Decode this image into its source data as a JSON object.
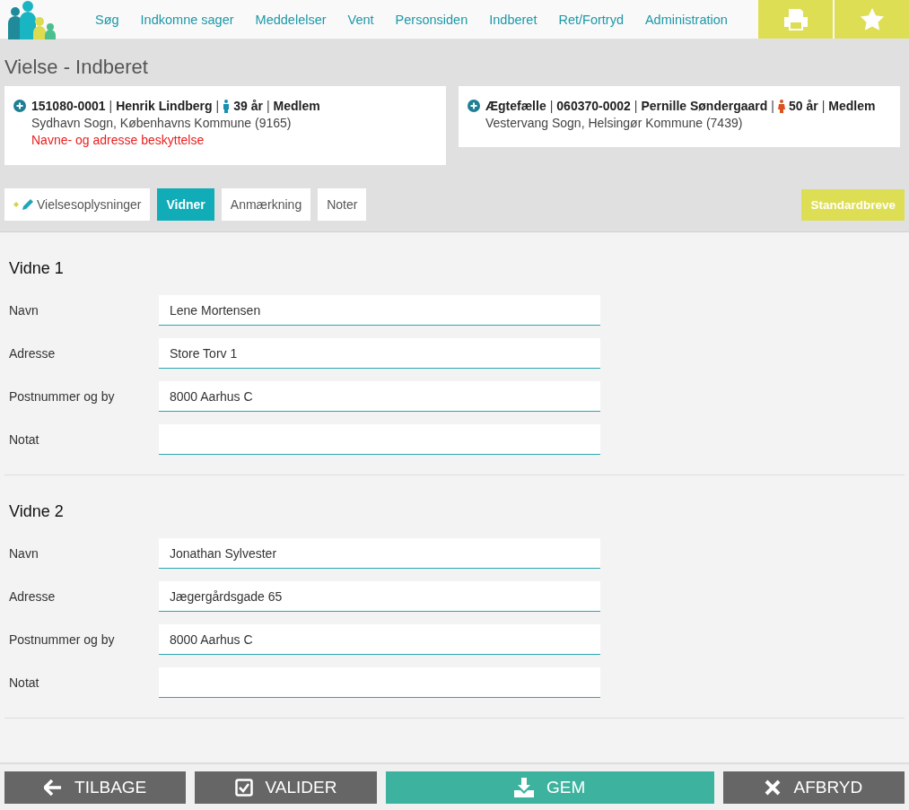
{
  "nav": {
    "items": [
      {
        "label": "Søg"
      },
      {
        "label": "Indkomne sager"
      },
      {
        "label": "Meddelelser"
      },
      {
        "label": "Vent"
      },
      {
        "label": "Personsiden"
      },
      {
        "label": "Indberet"
      },
      {
        "label": "Ret/Fortryd"
      },
      {
        "label": "Administration"
      }
    ],
    "actions": [
      {
        "kind": "print"
      },
      {
        "kind": "favorite"
      }
    ]
  },
  "page_title": "Vielse - Indberet",
  "persons": [
    {
      "separator": "|",
      "parts": [
        {
          "text": "151080-0001"
        },
        {
          "text": "Henrik Lindberg"
        },
        {
          "text": "39 år",
          "kind": "male"
        },
        {
          "text": "Medlem"
        }
      ],
      "address": "Sydhavn Sogn, Københavns Kommune (9165)",
      "warning": "Navne- og adresse beskyttelse"
    },
    {
      "separator": "|",
      "parts": [
        {
          "text": "Ægtefælle"
        },
        {
          "text": "060370-0002"
        },
        {
          "text": "Pernille Søndergaard"
        },
        {
          "text": "50 år",
          "kind": "female"
        },
        {
          "text": "Medlem"
        }
      ],
      "address": "Vestervang Sogn, Helsingør Kommune (7439)"
    }
  ],
  "tabs": [
    {
      "label": "Vielsesoplysninger",
      "selected": false,
      "edited": true
    },
    {
      "label": "Vidner",
      "selected": true,
      "edited": false
    },
    {
      "label": "Anmærkning",
      "selected": false,
      "edited": false
    },
    {
      "label": "Noter",
      "selected": false,
      "edited": false
    }
  ],
  "letters_button": "Standardbreve",
  "witnesses": [
    {
      "heading": "Vidne 1",
      "fields": [
        {
          "label": "Navn",
          "value": "Lene Mortensen"
        },
        {
          "label": "Adresse",
          "value": "Store Torv 1"
        },
        {
          "label": "Postnummer og by",
          "value": "8000 Aarhus C"
        },
        {
          "label": "Notat"
        }
      ]
    },
    {
      "heading": "Vidne 2",
      "fields": [
        {
          "label": "Navn",
          "value": "Jonathan Sylvester"
        },
        {
          "label": "Adresse",
          "value": "Jægergårdsgade 65"
        },
        {
          "label": "Postnummer og by",
          "value": "8000 Aarhus C"
        },
        {
          "label": "Notat"
        }
      ]
    }
  ],
  "footer": [
    {
      "kind": "back",
      "label": "TILBAGE"
    },
    {
      "kind": "validate",
      "label": "VALIDER"
    },
    {
      "kind": "save",
      "label": "GEM"
    },
    {
      "kind": "cancel",
      "label": "AFBRYD"
    }
  ]
}
